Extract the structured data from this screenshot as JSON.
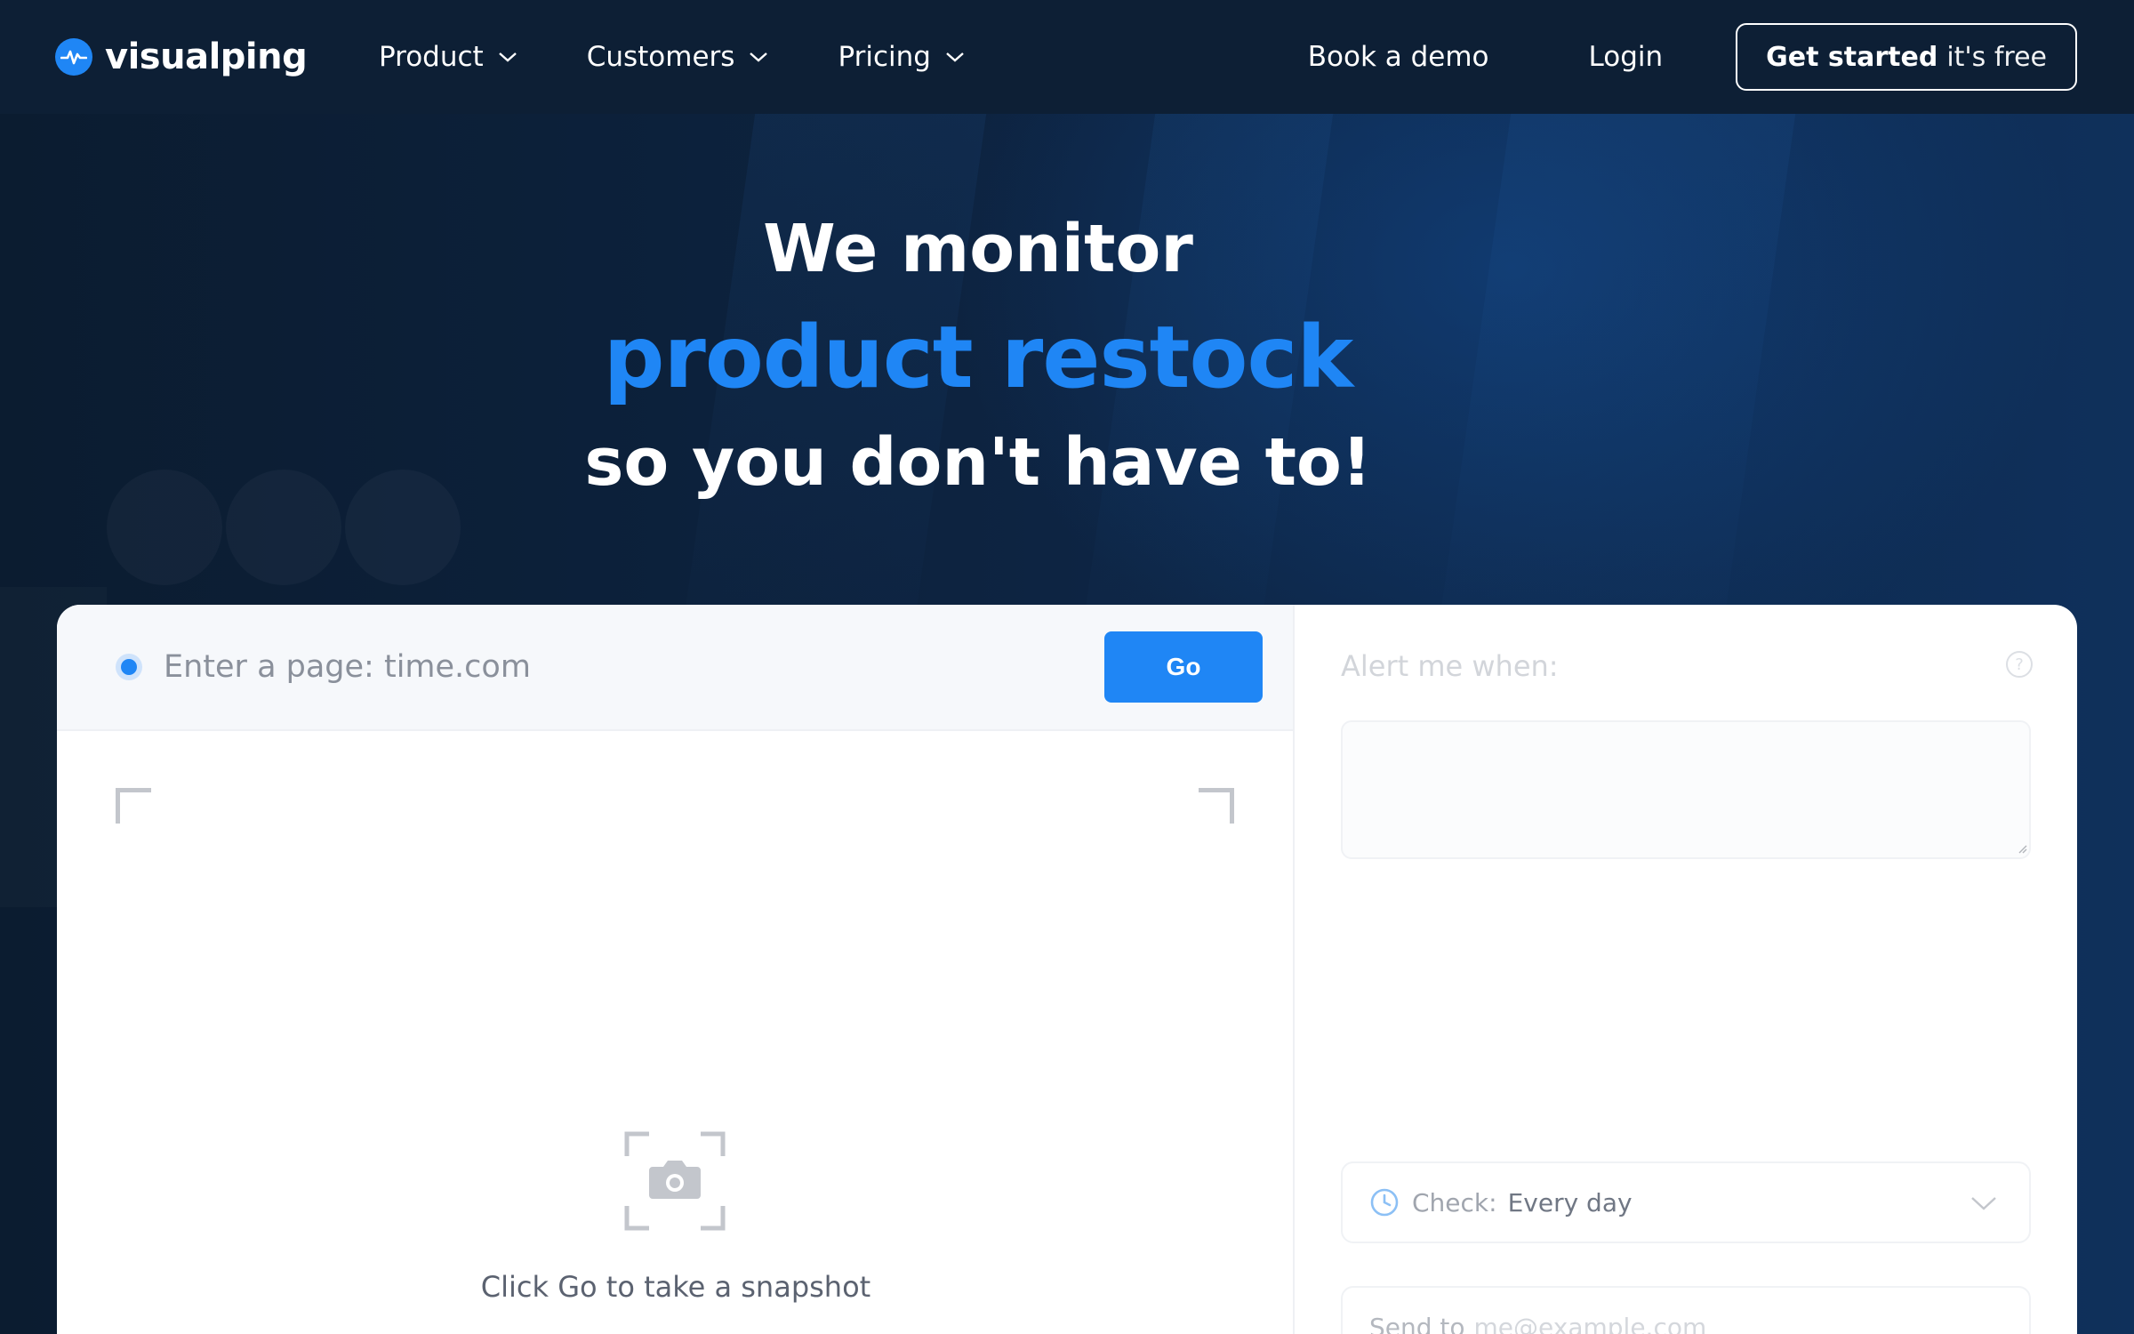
{
  "brand": {
    "name": "visualping",
    "accent": "#1f86f5",
    "nav_bg": "#0d1f35"
  },
  "nav": {
    "items": [
      {
        "label": "Product",
        "icon": "chevron-down-icon"
      },
      {
        "label": "Customers",
        "icon": "chevron-down-icon"
      },
      {
        "label": "Pricing",
        "icon": "chevron-down-icon"
      }
    ],
    "book_demo": "Book a demo",
    "login": "Login",
    "cta_strong": "Get started",
    "cta_light": "it's free"
  },
  "hero": {
    "line1": "We monitor",
    "line2": "product restock",
    "line3": "so you don't have to!"
  },
  "monitor": {
    "url_placeholder": "Enter a page: time.com",
    "go_label": "Go",
    "snapshot_caption": "Click Go to take a snapshot",
    "snapshot_icon": "camera-icon"
  },
  "settings": {
    "alert_label": "Alert me when:",
    "help_icon": "question-circle-icon",
    "check_label": "Check:",
    "check_value": "Every day",
    "check_icon": "clock-icon",
    "send_label": "Send to",
    "send_placeholder": "me@example.com"
  }
}
